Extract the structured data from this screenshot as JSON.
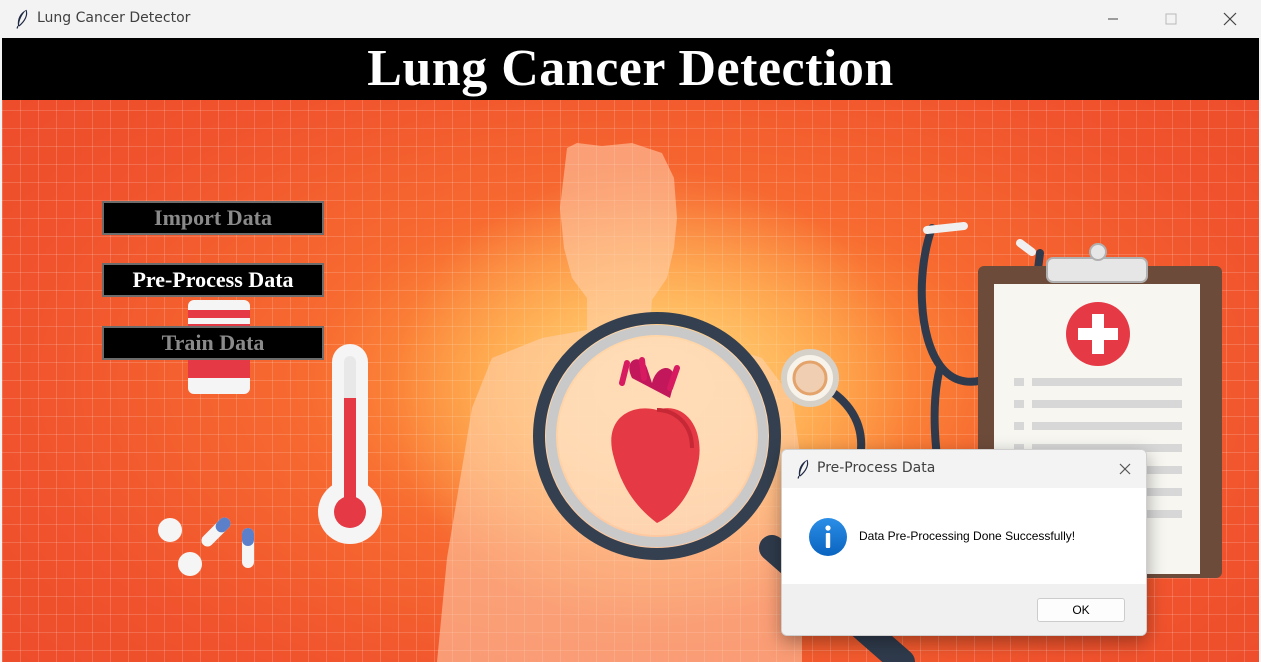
{
  "window": {
    "title": "Lung Cancer Detector",
    "minimize_icon": "minimize-icon",
    "maximize_icon": "maximize-icon",
    "close_icon": "close-icon"
  },
  "header": {
    "title": "Lung Cancer Detection"
  },
  "sidebar": {
    "buttons": [
      {
        "label": "Import Data",
        "state": "disabled"
      },
      {
        "label": "Pre-Process Data",
        "state": "enabled"
      },
      {
        "label": "Train Data",
        "state": "disabled"
      }
    ]
  },
  "background": {
    "description_icons": [
      "person-silhouette-illustration",
      "heart-icon",
      "magnifier-icon",
      "stethoscope-icon",
      "clipboard-icon",
      "thermometer-icon",
      "pills-icon",
      "medicine-bottle-icon"
    ]
  },
  "dialog": {
    "title": "Pre-Process Data",
    "message": "Data Pre-Processing Done Successfully!",
    "ok_label": "OK",
    "icon": "info-icon"
  },
  "colors": {
    "accent_bg": "#f0532d",
    "header_bg": "#000000",
    "info_blue": "#0a74d0"
  }
}
